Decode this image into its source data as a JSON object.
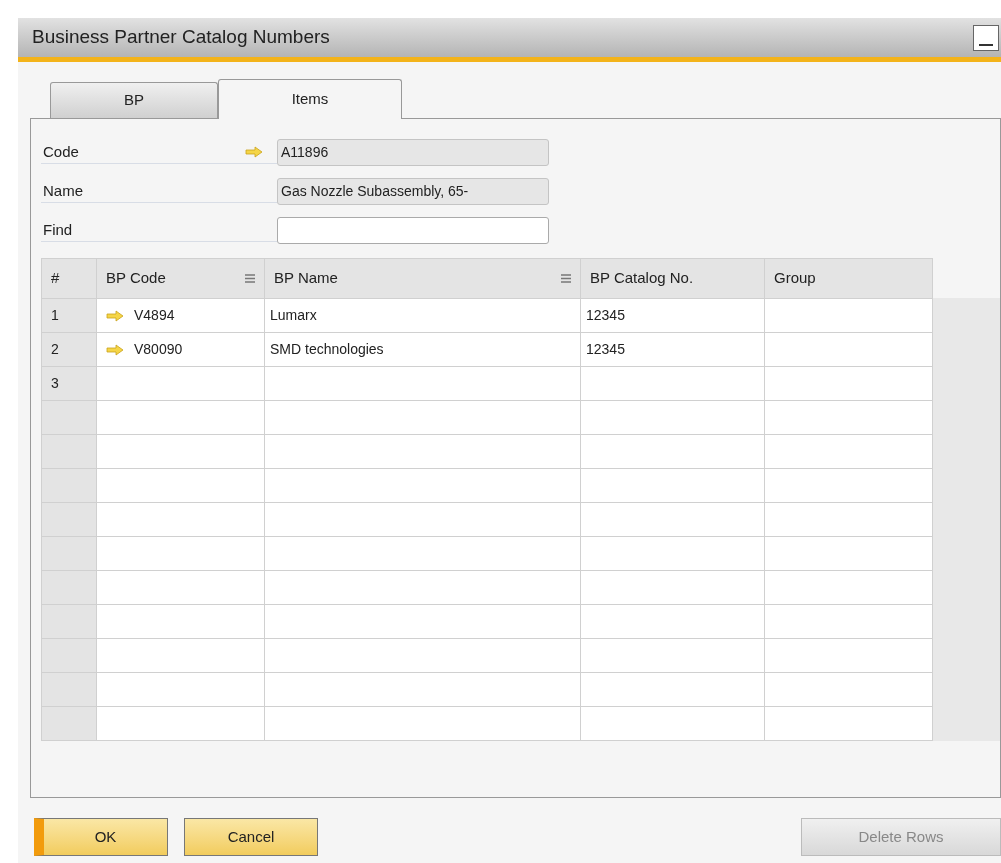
{
  "window": {
    "title": "Business Partner Catalog Numbers"
  },
  "tabs": [
    {
      "label": "BP",
      "selected": false
    },
    {
      "label": "Items",
      "selected": true
    }
  ],
  "fields": [
    {
      "label": "Code",
      "value": "A11896",
      "linked": true,
      "editable": false
    },
    {
      "label": "Name",
      "value": "Gas Nozzle Subassembly, 65-",
      "linked": false,
      "editable": false
    },
    {
      "label": "Find",
      "linked": false,
      "editable": true
    }
  ],
  "table": {
    "columns": [
      {
        "label": "#",
        "filter": false
      },
      {
        "label": "BP Code",
        "filter": true
      },
      {
        "label": "BP Name",
        "filter": true
      },
      {
        "label": "BP Catalog No.",
        "filter": false
      },
      {
        "label": "Group",
        "filter": false
      }
    ],
    "rows": [
      {
        "number": "1",
        "bp_code": "V4894",
        "bp_name": "Lumarx",
        "catalog_no": "12345"
      },
      {
        "number": "2",
        "bp_code": "V80090",
        "bp_name": "SMD technologies",
        "catalog_no": "12345"
      },
      {
        "number": "3"
      }
    ]
  },
  "buttons": [
    {
      "label": "OK",
      "default": true,
      "disabled": false
    },
    {
      "label": "Cancel",
      "default": false,
      "disabled": false
    },
    {
      "label": "Delete Rows",
      "default": false,
      "disabled": true
    }
  ]
}
